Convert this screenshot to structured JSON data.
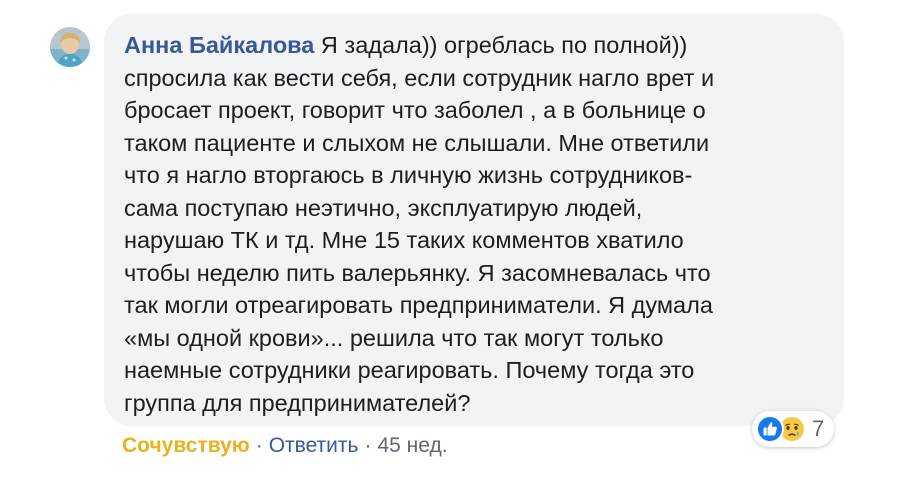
{
  "comment": {
    "author": "Анна Байкалова",
    "text_lines": [
      "Я задала)) огреблась по полной))",
      "спросила как вести себя, если сотрудник нагло врет и",
      "бросает проект, говорит что заболел , а в больнице о",
      "таком пациенте и слыхом не слышали. Мне ответили",
      "что я нагло вторгаюсь в личную жизнь сотрудников-",
      "сама поступаю неэтично, эксплуатирую людей,",
      "нарушаю ТК и тд. Мне 15 таких комментов хватило",
      "чтобы неделю пить валерьянку. Я засомневалась что",
      "так могли отреагировать предприниматели. Я думала",
      "«мы одной крови»... решила что так могут только",
      "наемные сотрудники реагировать. Почему тогда это",
      "группа для предпринимателей?"
    ]
  },
  "reactions": {
    "icons": [
      "like-icon",
      "sad-icon"
    ],
    "count": "7"
  },
  "actions": {
    "react_label": "Сочувствую",
    "reply_label": "Ответить",
    "separator": "·",
    "timestamp": "45 нед."
  },
  "colors": {
    "bubble_bg": "#f2f3f5",
    "author": "#385898",
    "link": "#385898",
    "reacted": "#e9b020",
    "text": "#1c1e21",
    "meta": "#606770",
    "like_blue": "#1877f2",
    "sad_yellow": "#f7c948"
  }
}
